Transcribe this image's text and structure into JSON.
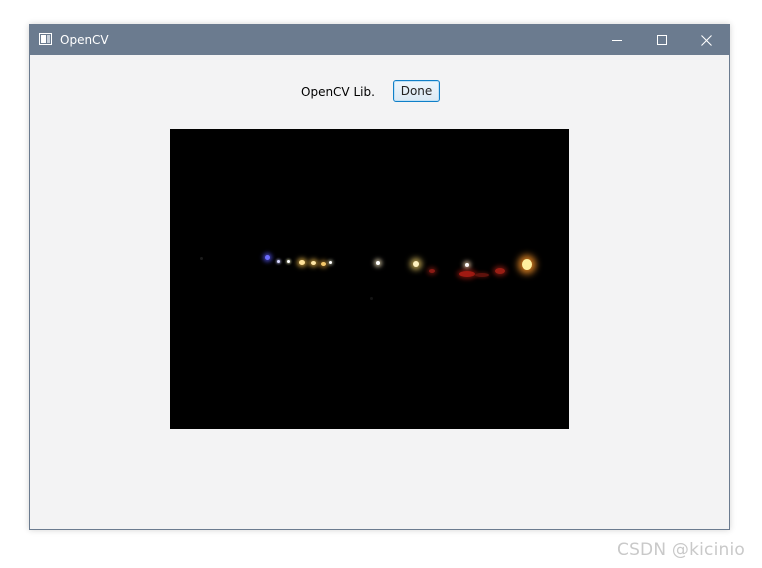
{
  "window": {
    "title": "OpenCV",
    "titlebar_color": "#6b7b8f",
    "icons": {
      "app": "window-app-icon",
      "minimize": "minimize-icon",
      "maximize": "maximize-icon",
      "close": "close-icon"
    }
  },
  "content": {
    "library_label": "OpenCV Lib.",
    "done_button_label": "Done",
    "image_description": "camera-frame"
  },
  "watermark": {
    "text": "CSDN @kicinio"
  }
}
